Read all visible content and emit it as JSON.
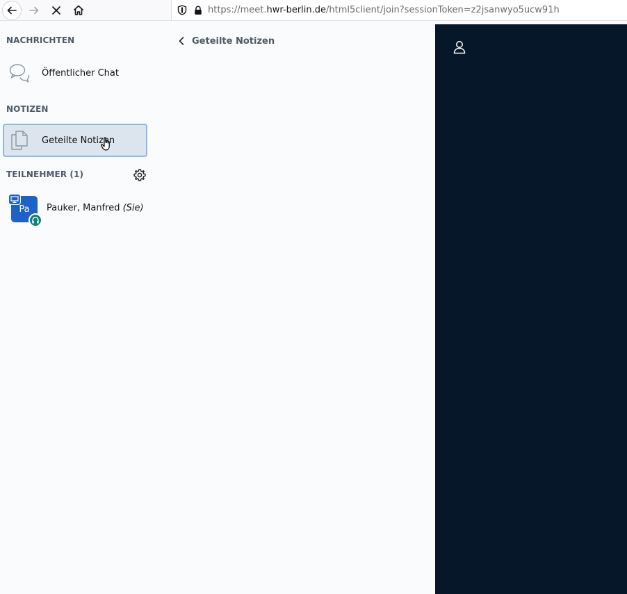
{
  "browser": {
    "url_prefix": "https://meet.",
    "url_host": "hwr-berlin.de",
    "url_path": "/html5client/join?sessionToken=z2jsanwyo5ucw91h"
  },
  "sidebar": {
    "messages_title": "NACHRICHTEN",
    "public_chat_label": "Öffentlicher Chat",
    "notes_title": "NOTIZEN",
    "shared_notes_label": "Geteilte Notizen",
    "participants_title": "TEILNEHMER (1)",
    "user": {
      "initials": "Pa",
      "name": "Pauker, Manfred",
      "self_tag": "(Sie)"
    }
  },
  "notes_panel": {
    "title": "Geteilte Notizen"
  },
  "colors": {
    "avatar": "#1e62c7",
    "audio_badge": "#0c8473",
    "dark_area": "#06172a",
    "selected_item": "#dce4ed"
  }
}
